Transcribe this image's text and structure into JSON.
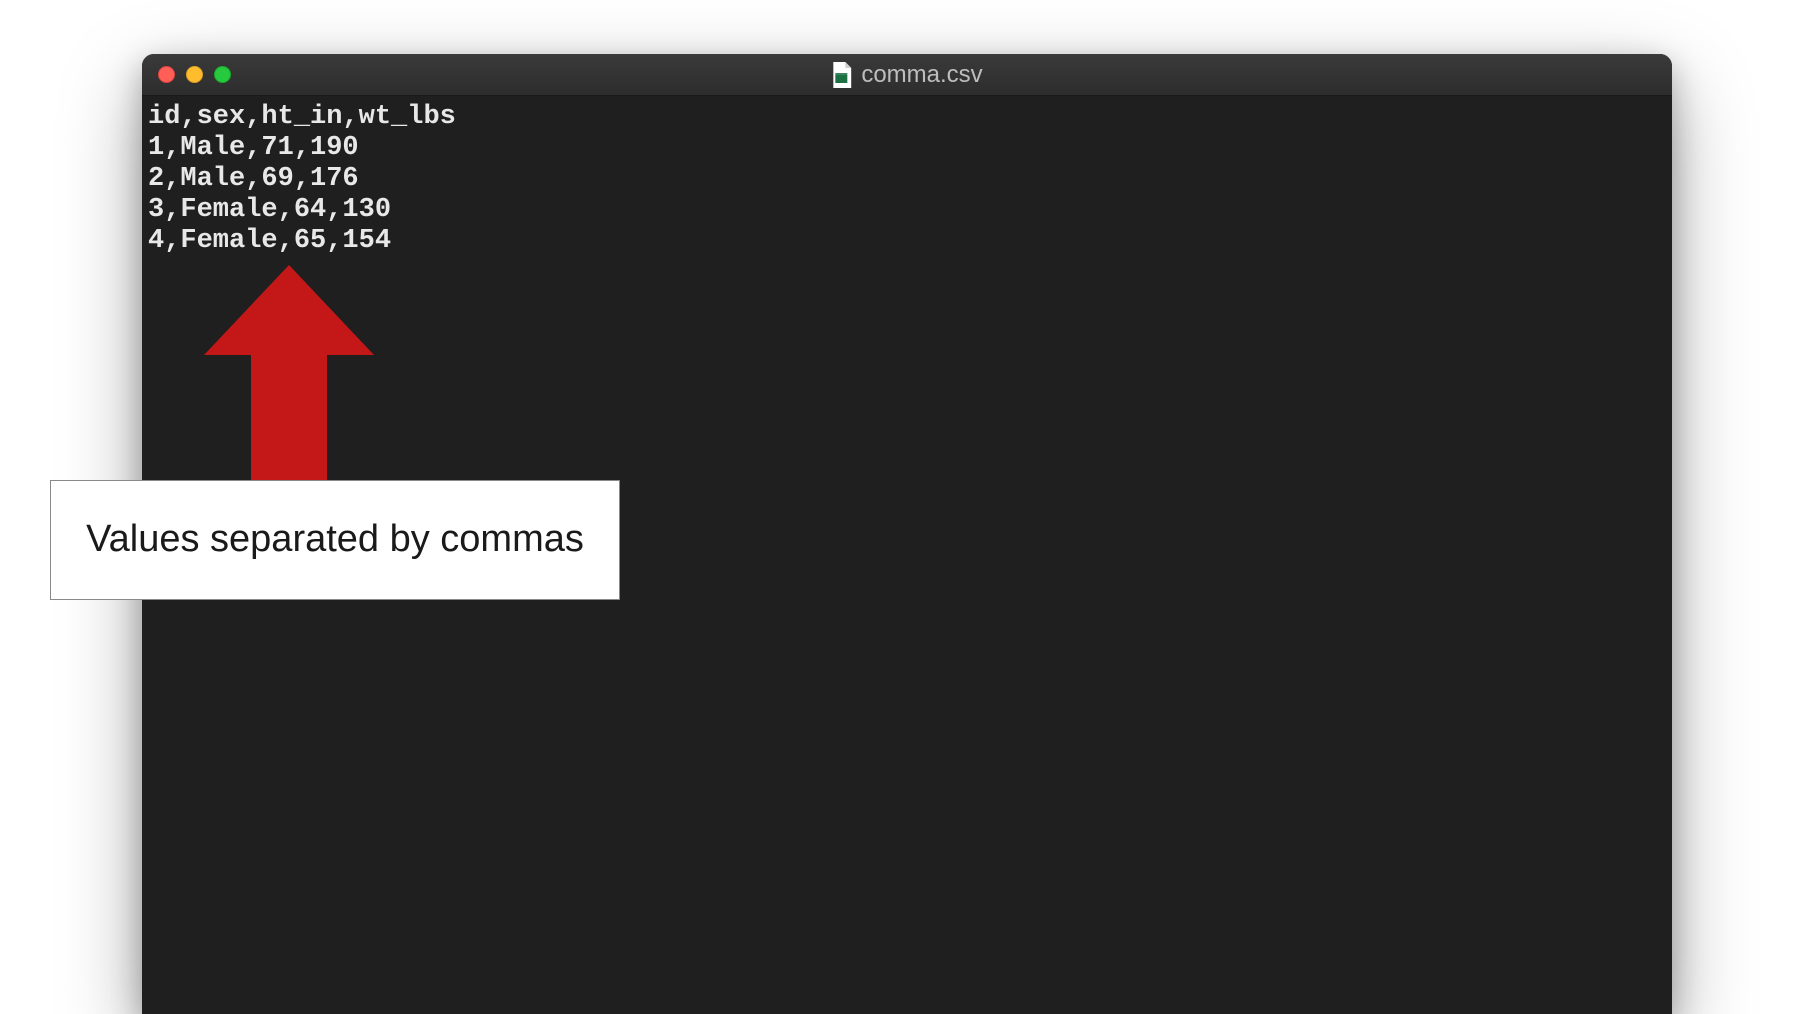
{
  "window": {
    "title": "comma.csv"
  },
  "csv": {
    "lines": [
      "id,sex,ht_in,wt_lbs",
      "1,Male,71,190",
      "2,Male,69,176",
      "3,Female,64,130",
      "4,Female,65,154"
    ]
  },
  "annotation": {
    "text": "Values separated by commas"
  },
  "colors": {
    "arrow": "#c41818",
    "window_bg": "#1f1f1f"
  }
}
